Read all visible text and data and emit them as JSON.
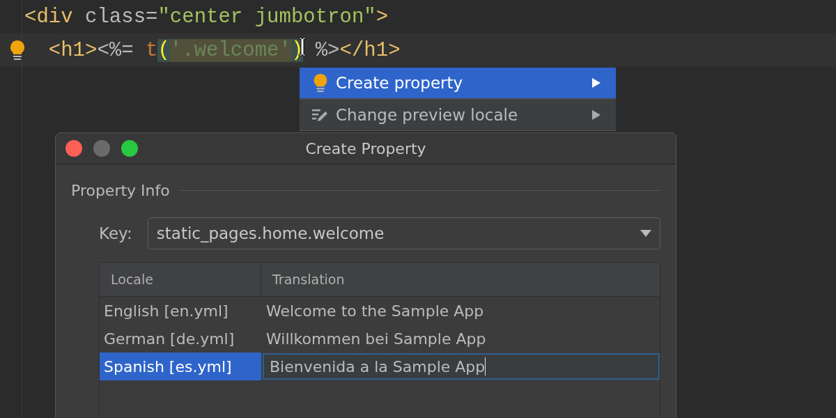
{
  "editor": {
    "lines": [
      {
        "bulb": false,
        "current": false,
        "tokens": [
          {
            "kind": "tag",
            "text": "<div"
          },
          {
            "kind": "attr",
            "text": " class="
          },
          {
            "kind": "string",
            "text": "\"center jumbotron\""
          },
          {
            "kind": "tag",
            "text": ">"
          }
        ]
      },
      {
        "bulb": true,
        "current": true,
        "tokens": [
          {
            "kind": "tag",
            "text": "  <h1>"
          },
          {
            "kind": "erb",
            "text": "<%= "
          },
          {
            "kind": "func",
            "text": "t"
          },
          {
            "kind": "brace",
            "text": "("
          },
          {
            "kind": "arg",
            "text": "'.welcome'"
          },
          {
            "kind": "brace",
            "text": ")"
          },
          {
            "kind": "erb",
            "text": " %>"
          },
          {
            "kind": "tag",
            "text": "</h1>"
          }
        ]
      }
    ]
  },
  "menu": {
    "items": [
      {
        "label": "Create property",
        "kind": "bulb",
        "selected": true
      },
      {
        "label": "Change preview locale",
        "kind": "edit",
        "selected": false
      }
    ]
  },
  "dialog": {
    "title": "Create Property",
    "section": "Property Info",
    "key_label": "Key:",
    "key_value": "static_pages.home.welcome",
    "table": {
      "columns": [
        "Locale",
        "Translation"
      ],
      "rows": [
        {
          "locale": "English [en.yml]",
          "translation": "Welcome to the Sample App",
          "selected": false
        },
        {
          "locale": "German [de.yml]",
          "translation": "Willkommen bei Sample App",
          "selected": false
        },
        {
          "locale": "Spanish [es.yml]",
          "translation": "Bienvenida a la Sample App",
          "selected": true
        }
      ]
    }
  }
}
